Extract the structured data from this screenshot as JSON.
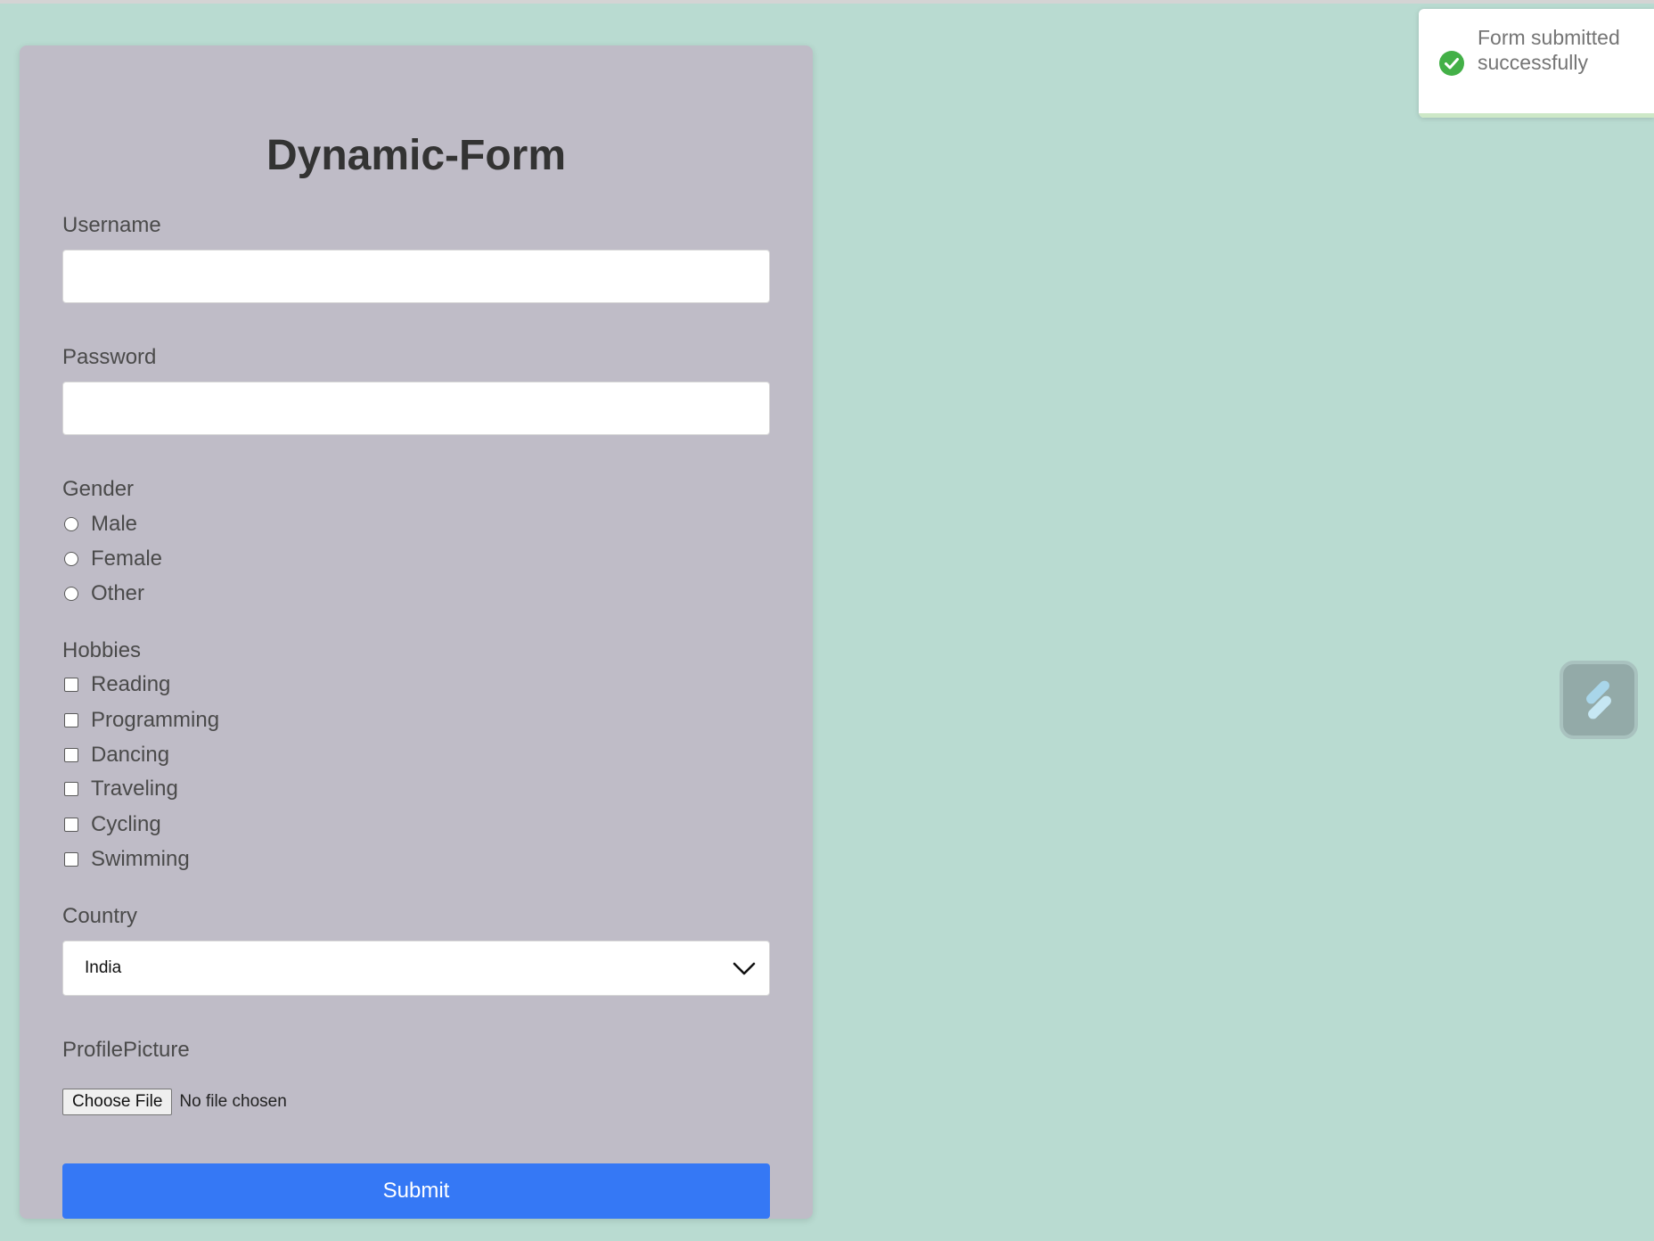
{
  "form": {
    "title": "Dynamic-Form",
    "username": {
      "label": "Username",
      "value": ""
    },
    "password": {
      "label": "Password",
      "value": ""
    },
    "gender": {
      "label": "Gender",
      "options": [
        "Male",
        "Female",
        "Other"
      ]
    },
    "hobbies": {
      "label": "Hobbies",
      "options": [
        "Reading",
        "Programming",
        "Dancing",
        "Traveling",
        "Cycling",
        "Swimming"
      ]
    },
    "country": {
      "label": "Country",
      "selected": "India"
    },
    "profile_picture": {
      "label": "ProfilePicture",
      "button_label": "Choose File",
      "status": "No file chosen"
    },
    "submit_label": "Submit"
  },
  "toast": {
    "message": "Form submitted successfully",
    "type": "success",
    "icon": "check-circle-icon",
    "progress": 1.0
  },
  "floating_widget": {
    "icon": "assistant-logo-icon"
  },
  "colors": {
    "page_background": "#b9dbd1",
    "card_background": "#bfbcc7",
    "submit_button": "#3578f5",
    "success_green": "#43b047",
    "title_text": "#333333",
    "label_text": "#4a4a4a"
  }
}
